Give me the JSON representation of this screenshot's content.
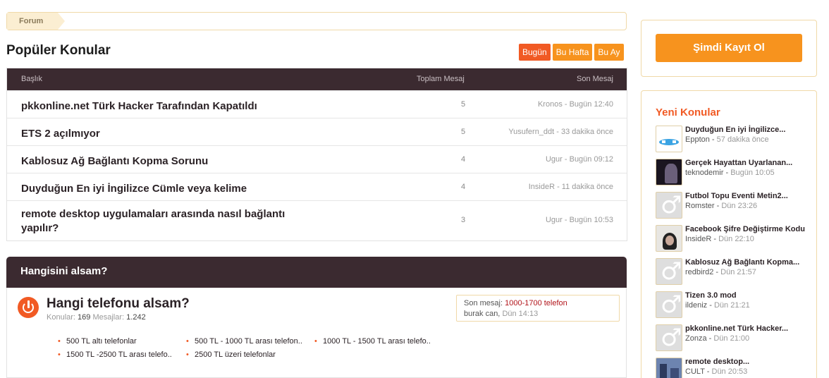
{
  "breadcrumb": {
    "label": "Forum"
  },
  "popular": {
    "title": "Popüler Konular",
    "filters": [
      "Bugün",
      "Bu Hafta",
      "Bu Ay"
    ],
    "columns": {
      "title": "Başlık",
      "count": "Toplam Mesaj",
      "last": "Son Mesaj"
    },
    "rows": [
      {
        "title": "pkkonline.net Türk Hacker Tarafından Kapatıldı",
        "count": "5",
        "last": "Kronos - Bugün 12:40"
      },
      {
        "title": "ETS 2 açılmıyor",
        "count": "5",
        "last": "Yusufern_ddt - 33 dakika önce"
      },
      {
        "title": "Kablosuz Ağ Bağlantı Kopma Sorunu",
        "count": "4",
        "last": "Ugur - Bugün 09:12"
      },
      {
        "title": "Duyduğun En iyi İngilizce Cümle veya kelime",
        "count": "4",
        "last": "InsideR - 11 dakika önce"
      },
      {
        "title": "remote desktop uygulamaları arasında nasıl bağlantı yapılır?",
        "count": "3",
        "last": "Ugur - Bugün 10:53"
      }
    ]
  },
  "category": {
    "title": "Hangisini alsam?",
    "forum": {
      "title": "Hangi telefonu alsam?",
      "topics_label": "Konular:",
      "topics": "169",
      "messages_label": "Mesajlar:",
      "messages": "1.242",
      "last_label": "Son mesaj:",
      "last_title": "1000-1700 telefon",
      "last_user": "burak can,",
      "last_time": "Dün 14:13",
      "subforums": [
        "500 TL altı telefonlar",
        "500 TL - 1000 TL arası telefon..",
        "1000 TL - 1500 TL arası telefo..",
        "1500 TL -2500 TL arası telefo..",
        "2500 TL üzeri telefonlar"
      ]
    }
  },
  "sidebar": {
    "register": "Şimdi Kayıt Ol",
    "new_title": "Yeni Konular",
    "threads": [
      {
        "title": "Duyduğun En iyi İngilizce...",
        "user": "Eppton",
        "time": "57 dakika önce",
        "avatar": "cat"
      },
      {
        "title": "Gerçek Hayattan Uyarlanan...",
        "user": "teknodemir",
        "time": "Bugün 10:05",
        "avatar": "dark"
      },
      {
        "title": "Futbol Topu Eventi Metin2...",
        "user": "Romster",
        "time": "Dün 23:26",
        "avatar": "male"
      },
      {
        "title": "Facebook Şifre Değiştirme Kodu",
        "user": "InsideR",
        "time": "Dün 22:10",
        "avatar": "face"
      },
      {
        "title": "Kablosuz Ağ Bağlantı Kopma...",
        "user": "redbird2",
        "time": "Dün 21:57",
        "avatar": "male"
      },
      {
        "title": "Tizen 3.0 mod",
        "user": "ildeniz",
        "time": "Dün 21:21",
        "avatar": "male"
      },
      {
        "title": "pkkonline.net Türk Hacker...",
        "user": "Zonza",
        "time": "Dün 21:00",
        "avatar": "male"
      },
      {
        "title": "remote desktop...",
        "user": "CULT",
        "time": "Dün 20:53",
        "avatar": "city"
      }
    ]
  }
}
